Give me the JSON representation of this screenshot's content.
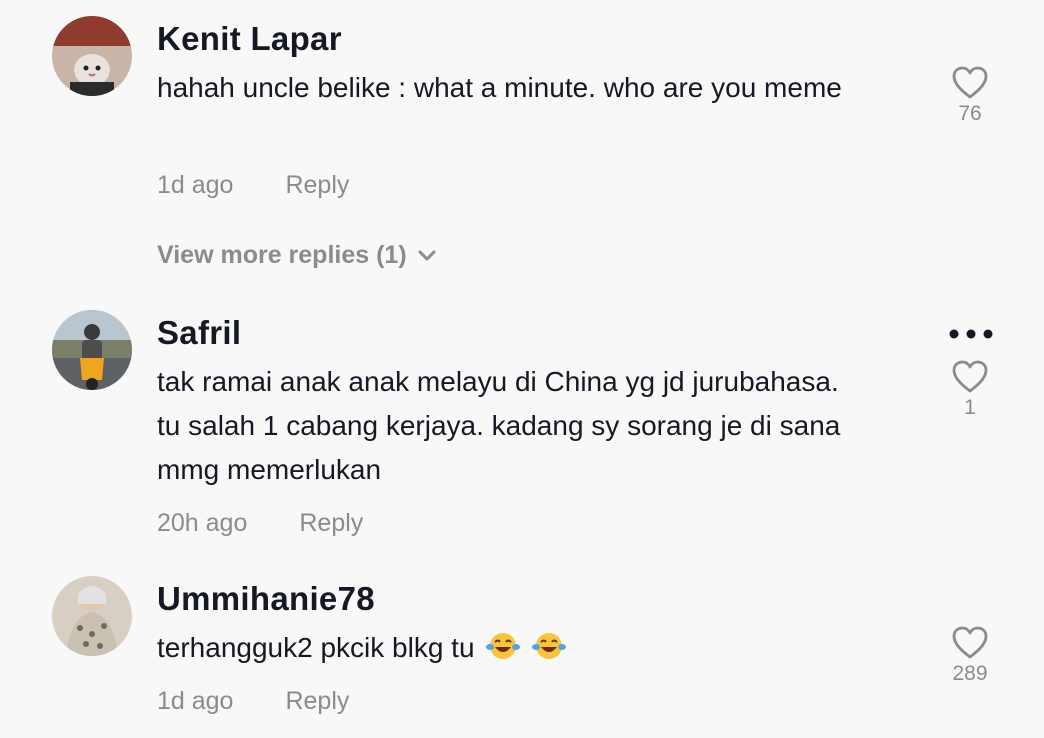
{
  "comments": [
    {
      "username": "Kenit Lapar",
      "text": "hahah uncle belike : what a minute. who are you meme",
      "time": "1d ago",
      "reply_label": "Reply",
      "likes": "76",
      "avatar_icon": "cat-avatar-icon"
    },
    {
      "username": "Safril",
      "text": "tak ramai anak anak melayu di China yg jd jurubahasa. tu salah 1 cabang kerjaya. kadang sy sorang je di sana mmg memerlukan",
      "time": "20h ago",
      "reply_label": "Reply",
      "likes": "1",
      "avatar_icon": "motorbike-avatar-icon"
    },
    {
      "username": "Ummihanie78",
      "text": "terhangguk2 pkcik blkg tu",
      "emojis": [
        "😂",
        "😂"
      ],
      "time": "1d ago",
      "reply_label": "Reply",
      "likes": "289",
      "avatar_icon": "person-avatar-icon"
    }
  ],
  "view_more_replies": "View more replies (1)",
  "colors": {
    "background": "#f8f8f8",
    "text": "#161823",
    "muted": "#8a8b91"
  }
}
